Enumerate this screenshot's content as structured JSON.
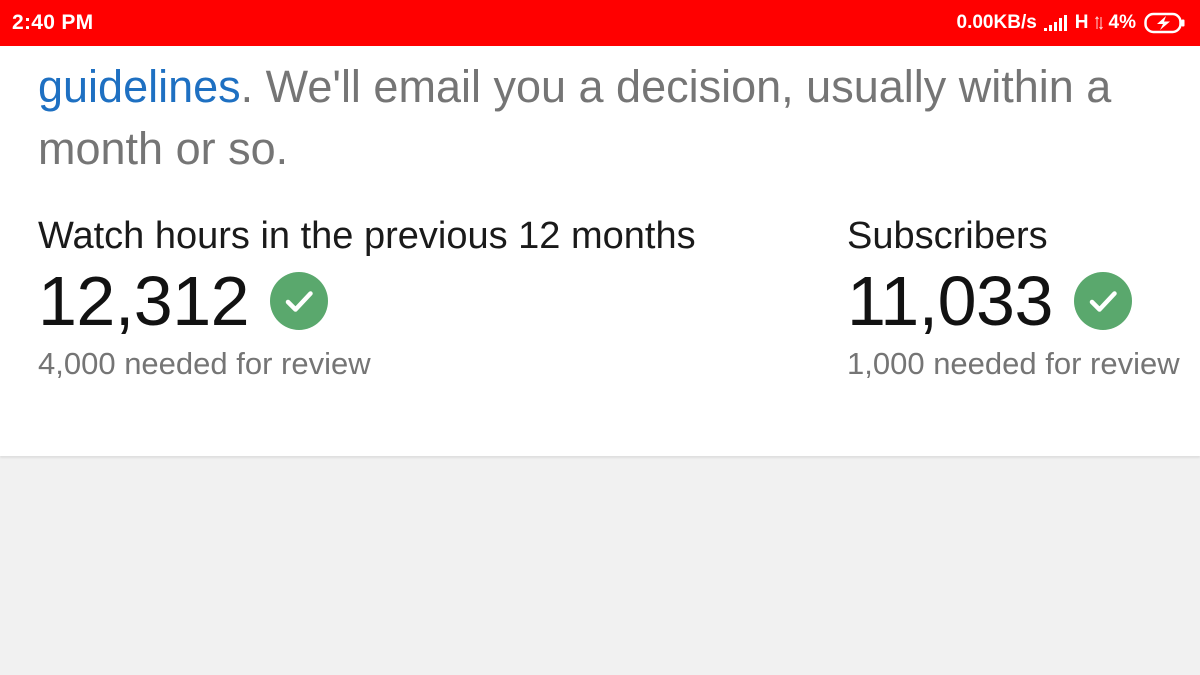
{
  "status_bar": {
    "time": "2:40 PM",
    "data_speed": "0.00KB/s",
    "network_type": "H",
    "battery_percent": "4%",
    "icons": [
      "signal-icon",
      "data-arrows-icon",
      "battery-charging-icon"
    ],
    "background_color": "#ff0000"
  },
  "intro": {
    "link_text": "guidelines",
    "rest_text": ". We'll email you a decision, usually within a month or so.",
    "link_color": "#1e70c2"
  },
  "metrics": {
    "watch_hours": {
      "label": "Watch hours in the previous 12 months",
      "value": "12,312",
      "requirement": "4,000 needed for review",
      "status_icon": "check-circle-icon",
      "status_color": "#5aa86d"
    },
    "subscribers": {
      "label": "Subscribers",
      "value": "11,033",
      "requirement": "1,000 needed for review",
      "status_icon": "check-circle-icon",
      "status_color": "#5aa86d"
    }
  }
}
